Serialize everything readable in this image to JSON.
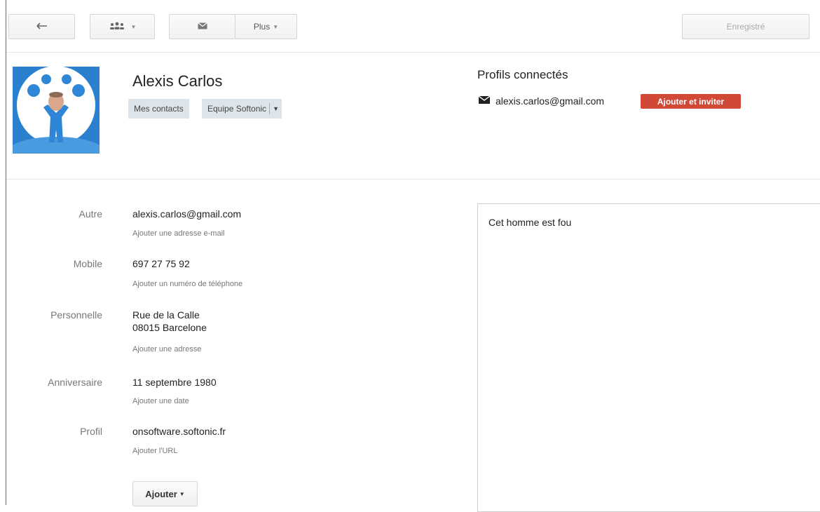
{
  "toolbar": {
    "back_icon": "arrow-left-icon",
    "groups_icon": "people-icon",
    "mail_icon": "envelope-icon",
    "more_label": "Plus",
    "saved_label": "Enregistré"
  },
  "contact": {
    "name": "Alexis Carlos",
    "tags": [
      "Mes contacts",
      "Equipe Softonic"
    ]
  },
  "connected_profiles": {
    "title": "Profils connectés",
    "email": "alexis.carlos@gmail.com",
    "invite_label": "Ajouter et inviter"
  },
  "fields": {
    "email": {
      "label": "Autre",
      "value": "alexis.carlos@gmail.com",
      "add": "Ajouter une adresse e-mail"
    },
    "phone": {
      "label": "Mobile",
      "value": "697 27 75 92",
      "add": "Ajouter un numéro de téléphone"
    },
    "address": {
      "label": "Personnelle",
      "line1": "Rue de la Calle",
      "line2": "08015 Barcelone",
      "add": "Ajouter une adresse"
    },
    "birthday": {
      "label": "Anniversaire",
      "value": "11 septembre 1980",
      "add": "Ajouter une date"
    },
    "profile": {
      "label": "Profil",
      "value": "onsoftware.softonic.fr",
      "add": "Ajouter l'URL"
    }
  },
  "add_button": "Ajouter",
  "notes": "Cet homme est fou",
  "colors": {
    "accent_red": "#d14836",
    "tag_bg": "#dde5ea",
    "watermark": "#29c3e6"
  }
}
